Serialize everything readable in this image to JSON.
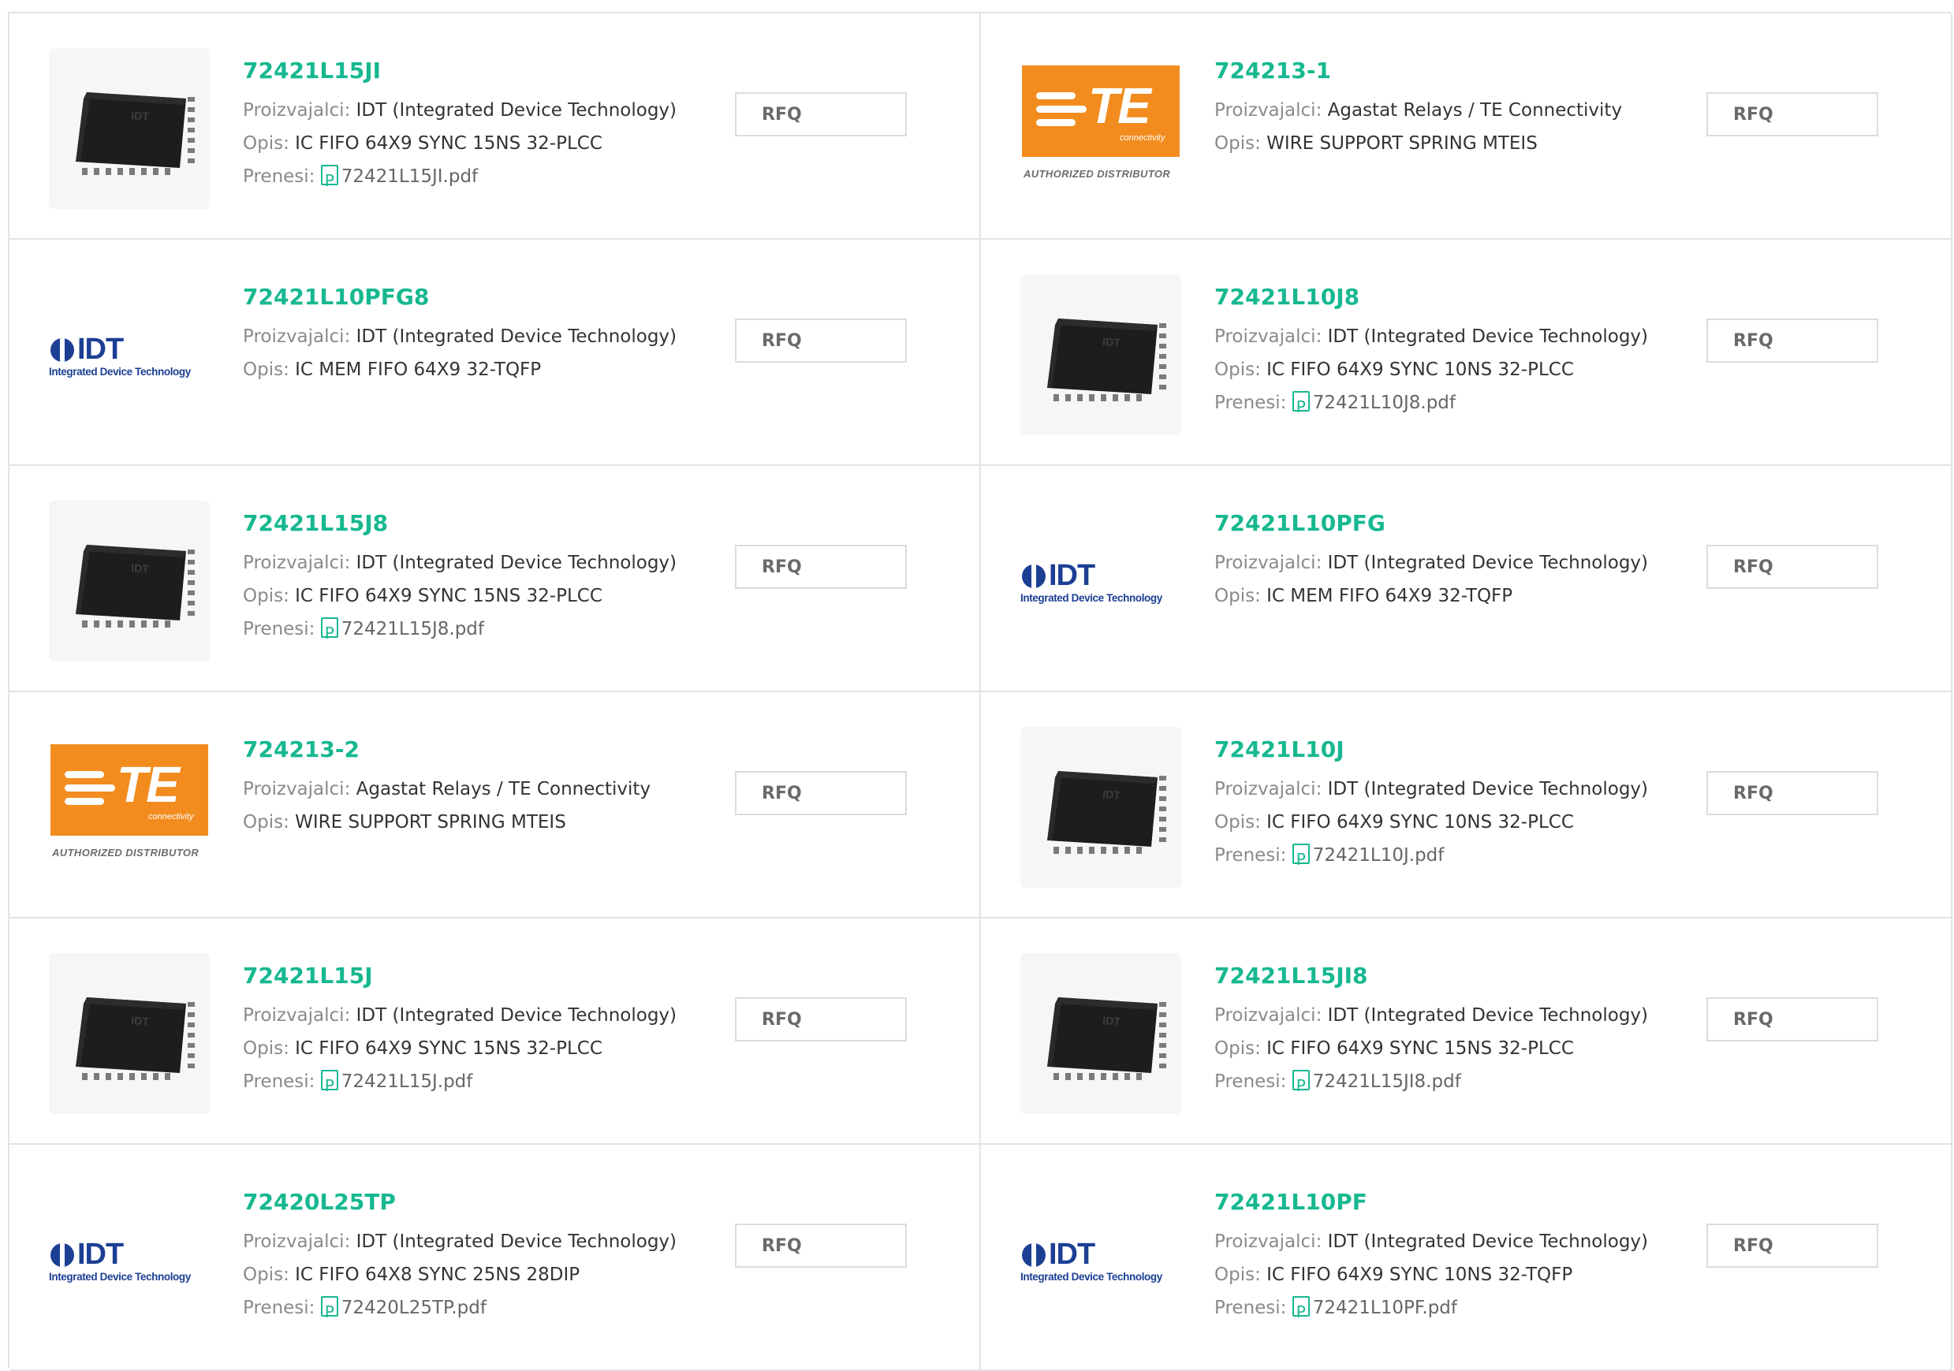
{
  "labels": {
    "manufacturer": "Proizvajalci:",
    "description": "Opis:",
    "download": "Prenesi:",
    "rfq": "RFQ",
    "te_brand": "TE",
    "te_sub": "connectivity",
    "te_authorized": "AUTHORIZED DISTRIBUTOR",
    "idt_brand": "IDT",
    "idt_sub": "Integrated Device Technology"
  },
  "products": [
    {
      "part": "72421L15JI",
      "image": "chip",
      "manufacturer": "IDT (Integrated Device Technology)",
      "description": "IC FIFO 64X9 SYNC 15NS 32-PLCC",
      "pdf": "72421L15JI.pdf"
    },
    {
      "part": "724213-1",
      "image": "te-logo",
      "manufacturer": "Agastat Relays / TE Connectivity",
      "description": "WIRE SUPPORT SPRING MTEIS",
      "pdf": null
    },
    {
      "part": "72421L10PFG8",
      "image": "idt-logo",
      "manufacturer": "IDT (Integrated Device Technology)",
      "description": "IC MEM FIFO 64X9 32-TQFP",
      "pdf": null
    },
    {
      "part": "72421L10J8",
      "image": "chip",
      "manufacturer": "IDT (Integrated Device Technology)",
      "description": "IC FIFO 64X9 SYNC 10NS 32-PLCC",
      "pdf": "72421L10J8.pdf"
    },
    {
      "part": "72421L15J8",
      "image": "chip",
      "manufacturer": "IDT (Integrated Device Technology)",
      "description": "IC FIFO 64X9 SYNC 15NS 32-PLCC",
      "pdf": "72421L15J8.pdf"
    },
    {
      "part": "72421L10PFG",
      "image": "idt-logo",
      "manufacturer": "IDT (Integrated Device Technology)",
      "description": "IC MEM FIFO 64X9 32-TQFP",
      "pdf": null
    },
    {
      "part": "724213-2",
      "image": "te-logo",
      "manufacturer": "Agastat Relays / TE Connectivity",
      "description": "WIRE SUPPORT SPRING MTEIS",
      "pdf": null
    },
    {
      "part": "72421L10J",
      "image": "chip",
      "manufacturer": "IDT (Integrated Device Technology)",
      "description": "IC FIFO 64X9 SYNC 10NS 32-PLCC",
      "pdf": "72421L10J.pdf"
    },
    {
      "part": "72421L15J",
      "image": "chip",
      "manufacturer": "IDT (Integrated Device Technology)",
      "description": "IC FIFO 64X9 SYNC 15NS 32-PLCC",
      "pdf": "72421L15J.pdf"
    },
    {
      "part": "72421L15JI8",
      "image": "chip",
      "manufacturer": "IDT (Integrated Device Technology)",
      "description": "IC FIFO 64X9 SYNC 15NS 32-PLCC",
      "pdf": "72421L15JI8.pdf"
    },
    {
      "part": "72420L25TP",
      "image": "idt-logo",
      "manufacturer": "IDT (Integrated Device Technology)",
      "description": "IC FIFO 64X8 SYNC 25NS 28DIP",
      "pdf": "72420L25TP.pdf"
    },
    {
      "part": "72421L10PF",
      "image": "idt-logo",
      "manufacturer": "IDT (Integrated Device Technology)",
      "description": "IC FIFO 64X9 SYNC 10NS 32-TQFP",
      "pdf": "72421L10PF.pdf"
    }
  ],
  "colors": {
    "accent": "#17b890",
    "idt_blue": "#1c3f94",
    "te_orange": "#f28c1e",
    "border": "#e3e3e3"
  }
}
